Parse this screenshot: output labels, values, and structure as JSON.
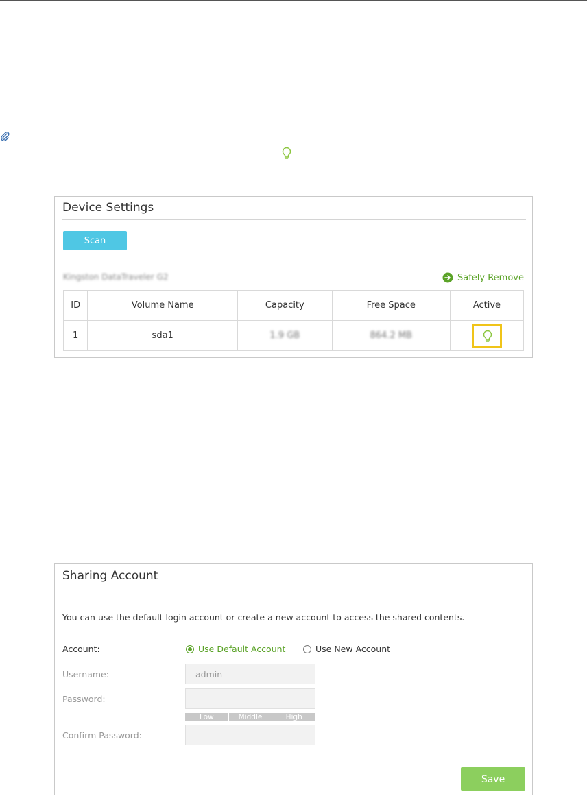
{
  "device_settings": {
    "title": "Device Settings",
    "scan_label": "Scan",
    "device_name": "Kingston DataTraveler G2",
    "safely_remove_label": "Safely Remove",
    "table": {
      "headers": [
        "ID",
        "Volume Name",
        "Capacity",
        "Free Space",
        "Active"
      ],
      "rows": [
        {
          "id": "1",
          "volume": "sda1",
          "capacity": "1.9 GB",
          "free_space": "864.2 MB",
          "active_icon": "bulb-icon"
        }
      ]
    }
  },
  "sharing_account": {
    "title": "Sharing Account",
    "description": "You can use the default login account or create a new account to access the shared contents.",
    "account_label": "Account:",
    "options": [
      "Use Default Account",
      "Use New Account"
    ],
    "selected_option": "Use Default Account",
    "username_label": "Username:",
    "username_value": "admin",
    "password_label": "Password:",
    "password_value": "",
    "strength_levels": [
      "Low",
      "Middle",
      "High"
    ],
    "confirm_label": "Confirm Password:",
    "confirm_value": "",
    "save_label": "Save"
  },
  "colors": {
    "accent_green": "#5ba328",
    "scan_blue": "#4fc7e4",
    "save_green": "#8ccf5e",
    "highlight_yellow": "#f0c419"
  }
}
